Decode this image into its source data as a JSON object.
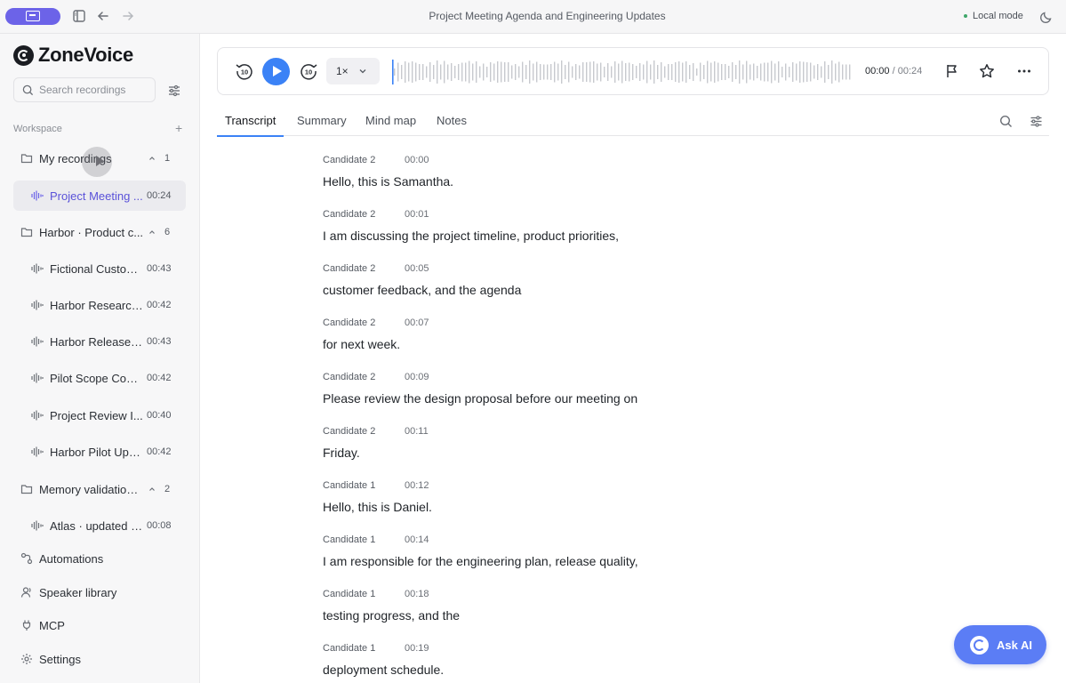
{
  "window": {
    "title": "Project Meeting Agenda and Engineering Updates",
    "mode_label": "Local mode"
  },
  "sidebar": {
    "brand": "ZoneVoice",
    "search_placeholder": "Search recordings",
    "workspace_label": "Workspace",
    "add_symbol": "+",
    "folders": [
      {
        "label": "My recordings",
        "count": "1",
        "items": [
          {
            "label": "Project Meeting ...",
            "duration": "00:24",
            "active": true
          }
        ]
      },
      {
        "label": "Harbor · Product c...",
        "count": "6",
        "items": [
          {
            "label": "Fictional Custom...",
            "duration": "00:43"
          },
          {
            "label": "Harbor Research ...",
            "duration": "00:42"
          },
          {
            "label": "Harbor Release P...",
            "duration": "00:43"
          },
          {
            "label": "Pilot Scope Confi...",
            "duration": "00:42"
          },
          {
            "label": "Project Review I...",
            "duration": "00:40"
          },
          {
            "label": "Harbor Pilot Upd...",
            "duration": "00:42"
          }
        ]
      },
      {
        "label": "Memory validation ...",
        "count": "2",
        "items": [
          {
            "label": "Atlas · updated d...",
            "duration": "00:08"
          }
        ]
      }
    ],
    "bottom_nav": [
      "Automations",
      "Speaker library",
      "MCP",
      "Settings"
    ]
  },
  "player": {
    "speed": "1×",
    "current_time": "00:00",
    "separator": " / ",
    "total_time": "00:24",
    "progress": 0
  },
  "tabs": [
    "Transcript",
    "Summary",
    "Mind map",
    "Notes"
  ],
  "active_tab": "Transcript",
  "transcript": [
    {
      "speaker": "Candidate 2",
      "time": "00:00",
      "text": "Hello, this is Samantha."
    },
    {
      "speaker": "Candidate 2",
      "time": "00:01",
      "text": "I am discussing the project timeline, product priorities,"
    },
    {
      "speaker": "Candidate 2",
      "time": "00:05",
      "text": "customer feedback, and the agenda"
    },
    {
      "speaker": "Candidate 2",
      "time": "00:07",
      "text": "for next week."
    },
    {
      "speaker": "Candidate 2",
      "time": "00:09",
      "text": "Please review the design proposal before our meeting on"
    },
    {
      "speaker": "Candidate 2",
      "time": "00:11",
      "text": "Friday."
    },
    {
      "speaker": "Candidate 1",
      "time": "00:12",
      "text": "Hello, this is Daniel."
    },
    {
      "speaker": "Candidate 1",
      "time": "00:14",
      "text": "I am responsible for the engineering plan, release quality,"
    },
    {
      "speaker": "Candidate 1",
      "time": "00:18",
      "text": "testing progress, and the"
    },
    {
      "speaker": "Candidate 1",
      "time": "00:19",
      "text": "deployment schedule."
    }
  ],
  "ask_ai": {
    "label": "Ask AI"
  },
  "colors": {
    "accent": "#6c63e8",
    "play": "#3b82f6",
    "ask_ai": "#5b7df5",
    "active_tab_underline": "#3b82f6"
  },
  "icons": {
    "titlebar": [
      "sidebar-toggle-icon",
      "panel-icon",
      "back-arrow-icon",
      "forward-arrow-icon",
      "moon-icon"
    ],
    "player": [
      "rewind-10-icon",
      "play-icon",
      "forward-10-icon",
      "chevron-down-icon",
      "flag-icon",
      "star-icon",
      "more-icon"
    ],
    "tabs": [
      "search-icon",
      "sliders-icon"
    ],
    "bottom_nav": [
      "automations-icon",
      "speaker-library-icon",
      "mcp-plug-icon",
      "settings-gear-icon"
    ]
  }
}
